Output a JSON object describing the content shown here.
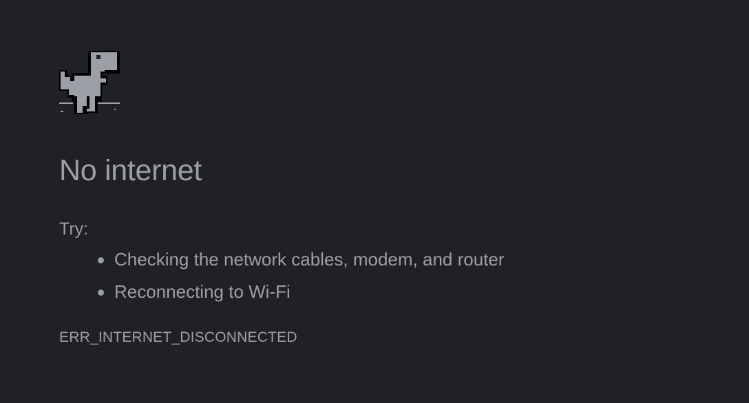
{
  "page": {
    "headline": "No internet",
    "suggestions_label": "Try:",
    "suggestions": [
      "Checking the network cables, modem, and router",
      "Reconnecting to Wi-Fi"
    ],
    "error_code": "ERR_INTERNET_DISCONNECTED"
  },
  "icons": {
    "dino": "offline-dinosaur-icon"
  },
  "colors": {
    "background": "#202124",
    "text": "#9aa0a6",
    "dino_body": "#9aa0a6",
    "dino_outline": "#000000"
  }
}
